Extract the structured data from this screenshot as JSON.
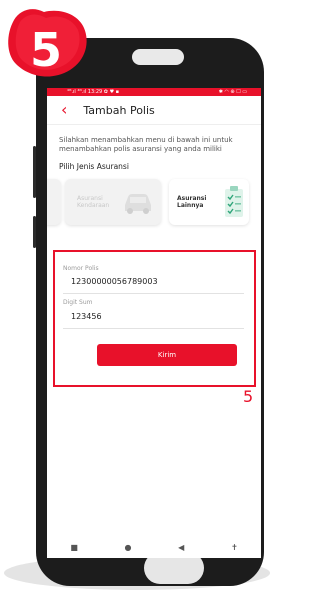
{
  "step_badge": "5",
  "status_bar": {
    "left": "⁴ᴳ.ıl ⁴ᴳ.ıl 13:29 ✿ ♥ ▪",
    "right": "✱ ◠ ⊕ ☐ ▭"
  },
  "header": {
    "title": "Tambah Polis"
  },
  "description": "Silahkan menambahkan menu di bawah ini untuk menambahkan polis asuransi yang anda miliki",
  "section_title": "Pilih Jenis Asuransi",
  "insurance_cards": [
    {
      "label": ""
    },
    {
      "label": "Asuransi\nKendaraan"
    },
    {
      "label": "Asuransi\nLainnya"
    }
  ],
  "form": {
    "policy_number_label": "Nomor Polis",
    "policy_number_value": "12300000056789003",
    "digit_sum_label": "Digit Sum",
    "digit_sum_value": "123456",
    "submit_label": "Kirim"
  },
  "step_annotation": "5",
  "nav_bar": {
    "square": "■",
    "circle": "●",
    "back": "◀",
    "accessibility": "✝"
  },
  "colors": {
    "primary": "#e8112a",
    "phone_body": "#1c1c1c"
  },
  "icons": [
    "back-arrow-icon",
    "car-icon",
    "checklist-icon"
  ]
}
